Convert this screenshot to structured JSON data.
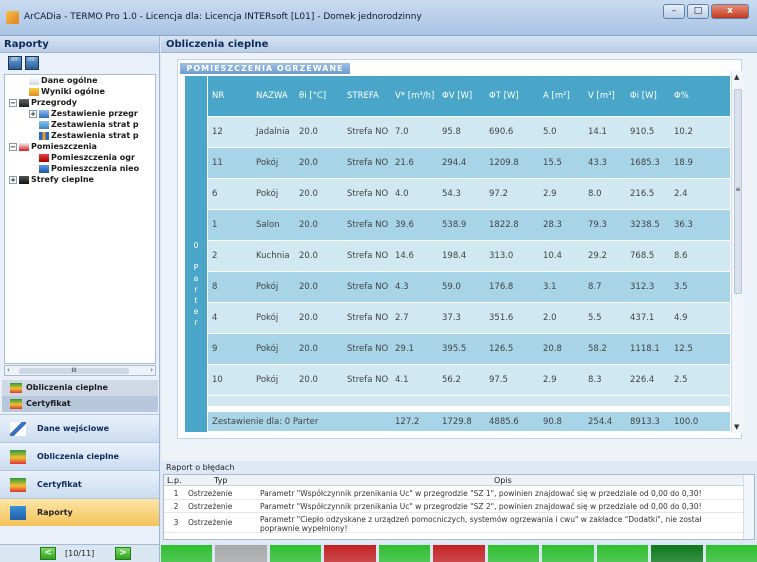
{
  "window": {
    "title": "ArCADia - TERMO Pro 1.0 - Licencja dla: Licencja INTERsoft [L01] - Domek jednorodzinny",
    "minimize": "–",
    "maximize": "□",
    "close": "x"
  },
  "left": {
    "header": "Raporty",
    "tree": [
      {
        "label": "Dane ogólne",
        "level": 1,
        "bold": true,
        "expander": "",
        "icon": "document-icon"
      },
      {
        "label": "Wyniki ogólne",
        "level": 1,
        "bold": true,
        "expander": "",
        "icon": "results-icon"
      },
      {
        "label": "Przegrody",
        "level": 0,
        "bold": true,
        "expander": "−",
        "icon": "wall-icon"
      },
      {
        "label": "Zestawienie przegr",
        "level": 2,
        "bold": true,
        "expander": "+",
        "icon": "stack-icon"
      },
      {
        "label": "Zestawienia strat p",
        "level": 2,
        "bold": true,
        "expander": "",
        "icon": "table-icon"
      },
      {
        "label": "Zestawienia strat p",
        "level": 2,
        "bold": true,
        "expander": "",
        "icon": "chart-icon"
      },
      {
        "label": "Pomieszczenia",
        "level": 0,
        "bold": true,
        "expander": "−",
        "icon": "room-icon"
      },
      {
        "label": "Pomieszczenia ogr",
        "level": 2,
        "bold": true,
        "expander": "",
        "icon": "room-heated-icon"
      },
      {
        "label": "Pomieszczenia nieo",
        "level": 2,
        "bold": true,
        "expander": "",
        "icon": "room-unheated-icon"
      },
      {
        "label": "Strefy cieplne",
        "level": 0,
        "bold": true,
        "expander": "+",
        "icon": "zone-icon"
      }
    ],
    "tree_scroll_thumb": "III",
    "small_tabs": [
      "Obliczenia cieplne",
      "Certyfikat"
    ],
    "nav": [
      "Dane wejściowe",
      "Obliczenia cieplne",
      "Certyfikat",
      "Raporty"
    ],
    "pager": {
      "prev": "<",
      "label": "[10/11]",
      "next": ">"
    }
  },
  "main": {
    "header": "Obliczenia cieplne",
    "section": "POMIESZCZENIA OGRZEWANE",
    "floor_label": [
      "0",
      "",
      "P",
      "a",
      "r",
      "t",
      "e",
      "r"
    ],
    "columns": [
      "NR",
      "NAZWA",
      "θi [°C]",
      "STREFA",
      "V* [m³/h]",
      "ΦV [W]",
      "ΦT [W]",
      "A [m²]",
      "V [m³]",
      "Φi [W]",
      "Φ%"
    ],
    "rows": [
      [
        "12",
        "Jadalnia",
        "20.0",
        "Strefa NO",
        "7.0",
        "95.8",
        "690.6",
        "5.0",
        "14.1",
        "910.5",
        "10.2"
      ],
      [
        "11",
        "Pokój",
        "20.0",
        "Strefa NO",
        "21.6",
        "294.4",
        "1209.8",
        "15.5",
        "43.3",
        "1685.3",
        "18.9"
      ],
      [
        "6",
        "Pokój",
        "20.0",
        "Strefa NO",
        "4.0",
        "54.3",
        "97.2",
        "2.9",
        "8.0",
        "216.5",
        "2.4"
      ],
      [
        "1",
        "Salon",
        "20.0",
        "Strefa NO",
        "39.6",
        "538.9",
        "1822.8",
        "28.3",
        "79.3",
        "3238.5",
        "36.3"
      ],
      [
        "2",
        "Kuchnia",
        "20.0",
        "Strefa NO",
        "14.6",
        "198.4",
        "313.0",
        "10.4",
        "29.2",
        "768.5",
        "8.6"
      ],
      [
        "8",
        "Pokój",
        "20.0",
        "Strefa NO",
        "4.3",
        "59.0",
        "176.8",
        "3.1",
        "8.7",
        "312.3",
        "3.5"
      ],
      [
        "4",
        "Pokój",
        "20.0",
        "Strefa NO",
        "2.7",
        "37.3",
        "351.6",
        "2.0",
        "5.5",
        "437.1",
        "4.9"
      ],
      [
        "9",
        "Pokój",
        "20.0",
        "Strefa NO",
        "29.1",
        "395.5",
        "126.5",
        "20.8",
        "58.2",
        "1118.1",
        "12.5"
      ],
      [
        "10",
        "Pokój",
        "20.0",
        "Strefa NO",
        "4.1",
        "56.2",
        "97.5",
        "2.9",
        "8.3",
        "226.4",
        "2.5"
      ]
    ],
    "summary": {
      "label": "Zestawienie dla: 0 Parter",
      "values": [
        "127.2",
        "1729.8",
        "4885.6",
        "90.8",
        "254.4",
        "8913.3",
        "100.0"
      ]
    },
    "scroll_thumb": "≡"
  },
  "errors": {
    "title": "Raport o błędach",
    "columns": [
      "L.p.",
      "Typ",
      "Opis"
    ],
    "rows": [
      {
        "lp": "1",
        "type": "Ostrzeżenie",
        "desc": "Parametr \"Współczynnik przenikania Uc\" w przegrodzie \"SZ 1\", powinien znajdować się w przedziale od 0,00 do 0,30!"
      },
      {
        "lp": "2",
        "type": "Ostrzeżenie",
        "desc": "Parametr \"Współczynnik przenikania Uc\" w przegrodzie \"SZ 2\", powinien znajdować się w przedziale od 0,00 do 0,30!"
      },
      {
        "lp": "3",
        "type": "Ostrzeżenie",
        "desc": "Parametr \"Ciepło odzyskane z urządzeń pomocniczych, systemów ogrzewania i cwu\" w zakładce \"Dodatki\", nie został poprawnie wypełniony!"
      }
    ]
  },
  "status_colors": [
    "#2fbf2f",
    "#a9a9a9",
    "#2fbf2f",
    "#c42222",
    "#2fbf2f",
    "#c42222",
    "#2fbf2f",
    "#2fbf2f",
    "#2fbf2f",
    "#0e7a1a",
    "#2fbf2f"
  ]
}
